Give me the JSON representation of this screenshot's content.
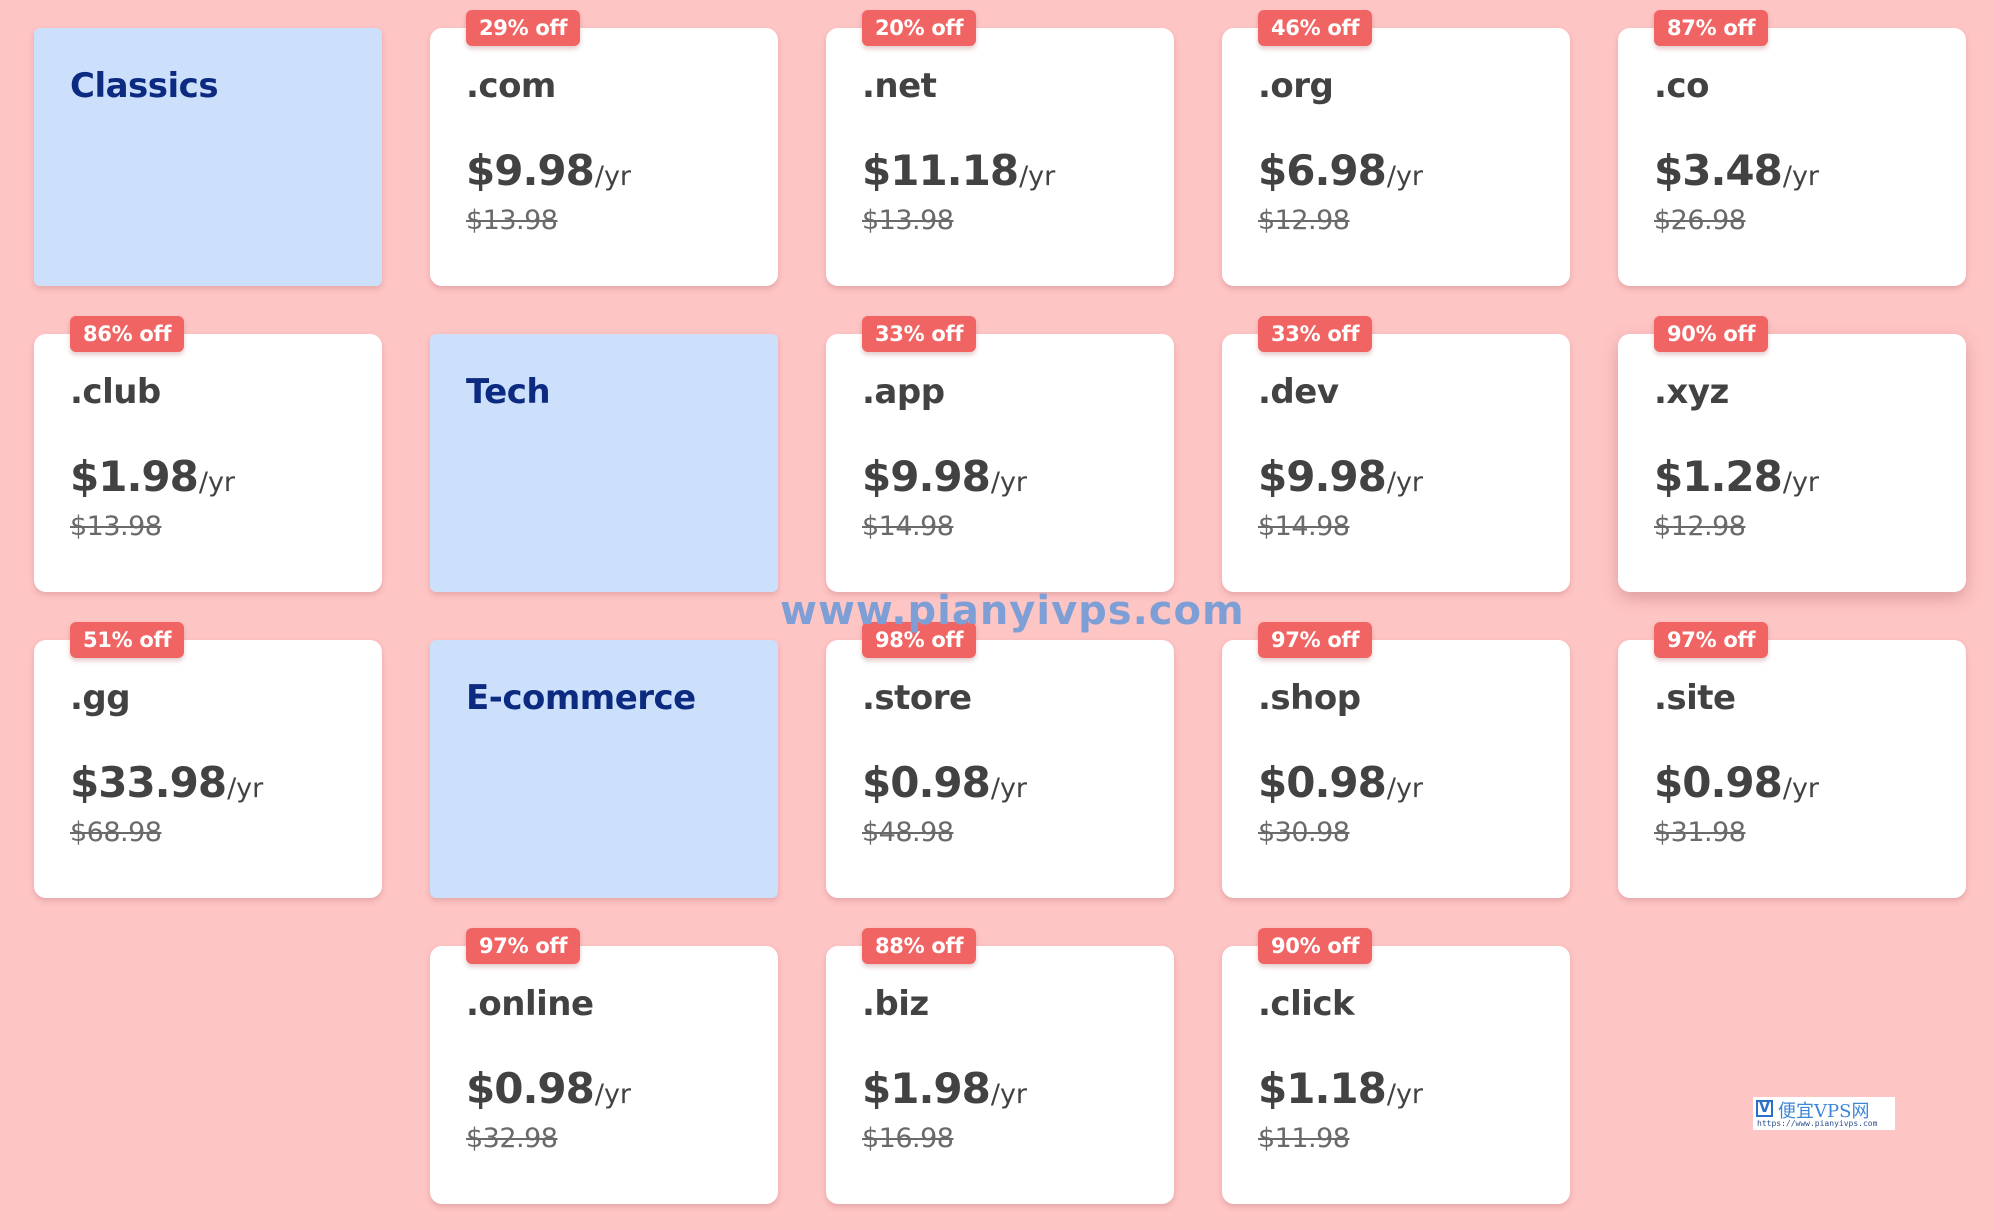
{
  "colors": {
    "background": "#fec5c5",
    "card": "#ffffff",
    "category_card": "#cce0fc",
    "category_text": "#0b2a80",
    "badge": "#f16464",
    "text": "#424242",
    "old_price": "#6a6a6a"
  },
  "per_year_label": "/yr",
  "categories": {
    "classics": "Classics",
    "tech": "Tech",
    "ecommerce": "E-commerce"
  },
  "domains": [
    {
      "tld": ".com",
      "badge": "29% off",
      "price": "$9.98",
      "old_price": "$13.98"
    },
    {
      "tld": ".net",
      "badge": "20% off",
      "price": "$11.18",
      "old_price": "$13.98"
    },
    {
      "tld": ".org",
      "badge": "46% off",
      "price": "$6.98",
      "old_price": "$12.98"
    },
    {
      "tld": ".co",
      "badge": "87% off",
      "price": "$3.48",
      "old_price": "$26.98"
    },
    {
      "tld": ".club",
      "badge": "86% off",
      "price": "$1.98",
      "old_price": "$13.98"
    },
    {
      "tld": ".app",
      "badge": "33% off",
      "price": "$9.98",
      "old_price": "$14.98"
    },
    {
      "tld": ".dev",
      "badge": "33% off",
      "price": "$9.98",
      "old_price": "$14.98"
    },
    {
      "tld": ".xyz",
      "badge": "90% off",
      "price": "$1.28",
      "old_price": "$12.98"
    },
    {
      "tld": ".gg",
      "badge": "51% off",
      "price": "$33.98",
      "old_price": "$68.98"
    },
    {
      "tld": ".store",
      "badge": "98% off",
      "price": "$0.98",
      "old_price": "$48.98"
    },
    {
      "tld": ".shop",
      "badge": "97% off",
      "price": "$0.98",
      "old_price": "$30.98"
    },
    {
      "tld": ".site",
      "badge": "97% off",
      "price": "$0.98",
      "old_price": "$31.98"
    },
    {
      "tld": ".online",
      "badge": "97% off",
      "price": "$0.98",
      "old_price": "$32.98"
    },
    {
      "tld": ".biz",
      "badge": "88% off",
      "price": "$1.98",
      "old_price": "$16.98"
    },
    {
      "tld": ".click",
      "badge": "90% off",
      "price": "$1.18",
      "old_price": "$11.98"
    }
  ],
  "watermark": {
    "text": "www.pianyivps.com",
    "logo_icon": "V",
    "logo_name": "便宜VPS网",
    "logo_url": "https://www.pianyivps.com"
  }
}
